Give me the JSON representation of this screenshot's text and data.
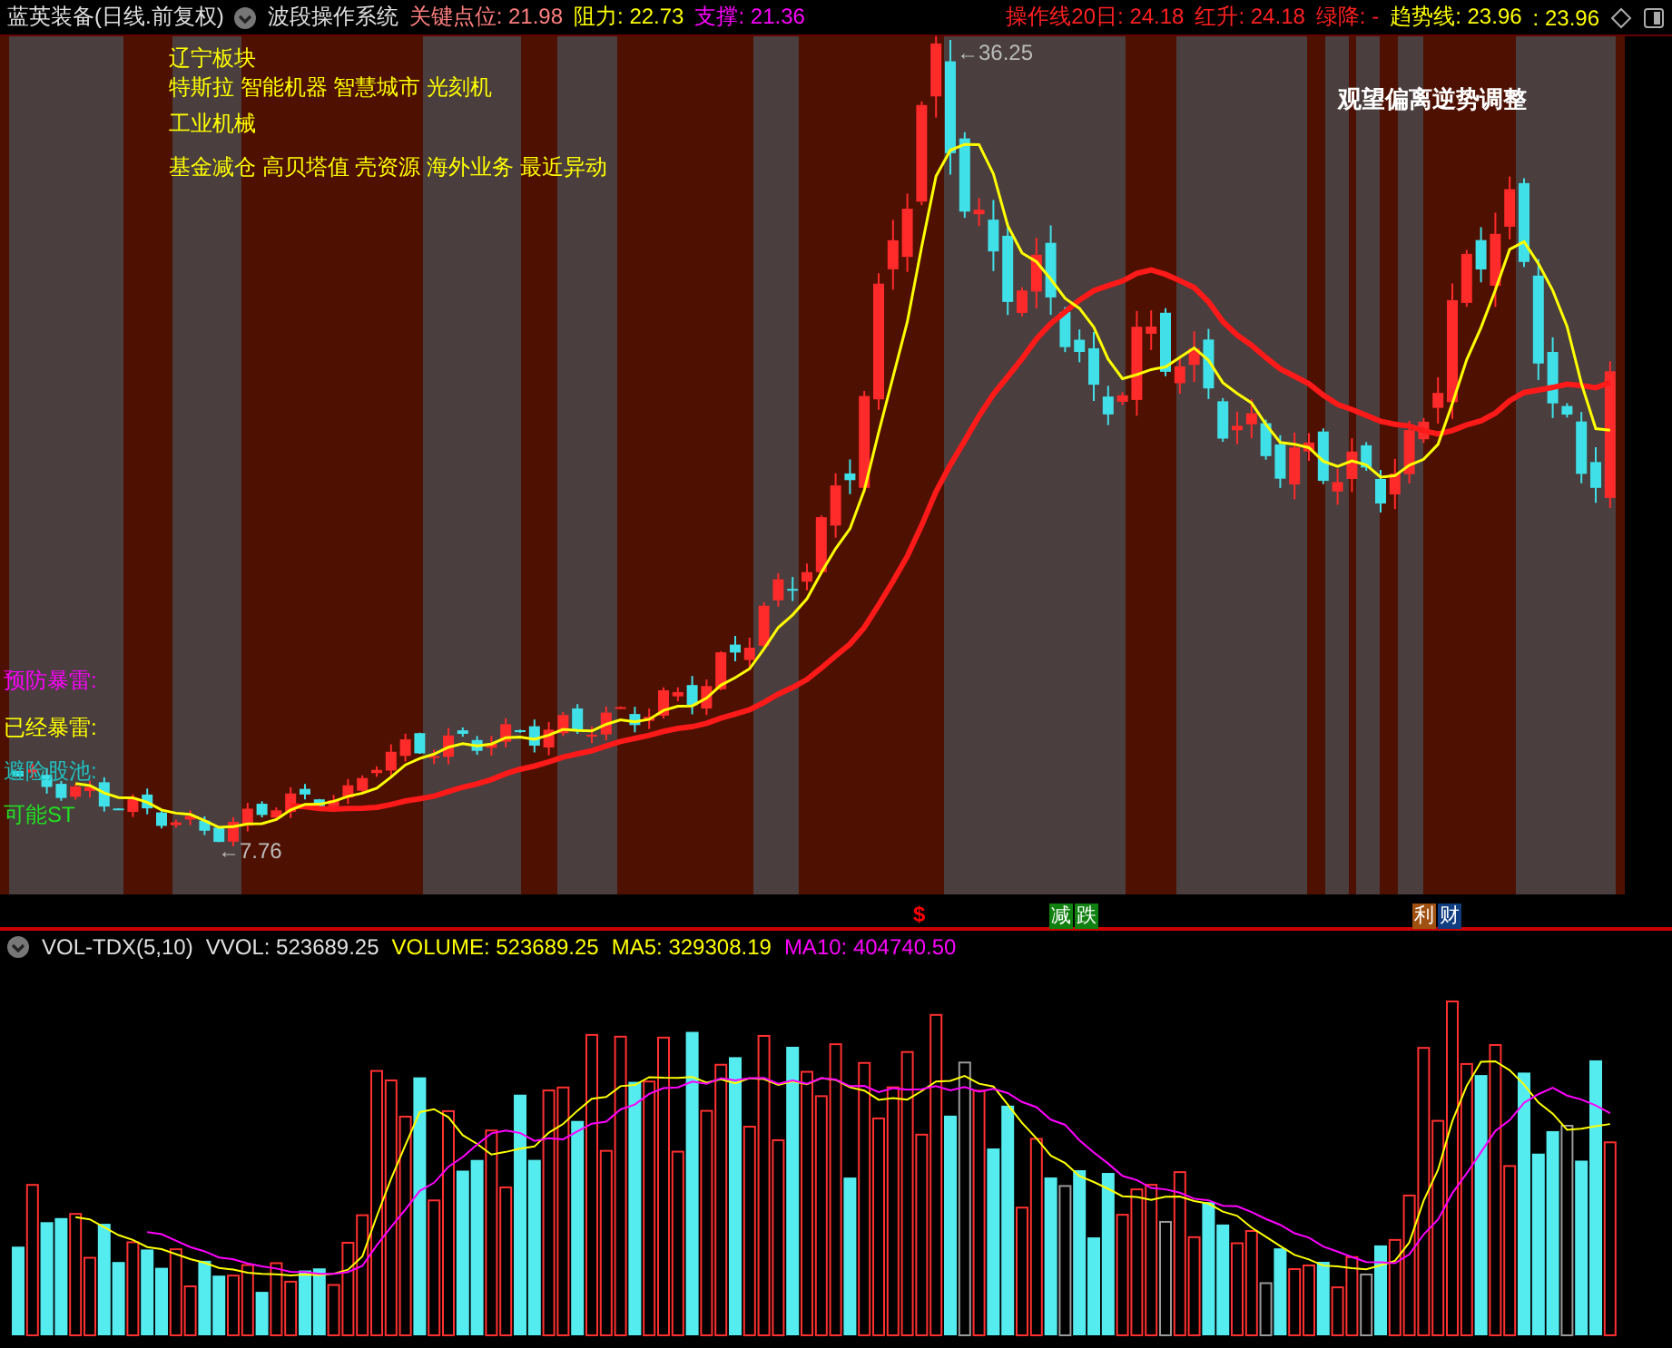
{
  "header": {
    "stock": "蓝英装备(日线.前复权)",
    "system": "波段操作系统",
    "indicators": [
      {
        "text": "关键点位: 21.98",
        "color": "#ff7f7f"
      },
      {
        "text": "阻力: 22.73",
        "color": "#ffff00"
      },
      {
        "text": "支撑: 21.36",
        "color": "#ff00ff"
      }
    ],
    "right_indicators": [
      {
        "text": "操作线20日: 24.18",
        "color": "#ff2020"
      },
      {
        "text": "红升: 24.18",
        "color": "#ff2020"
      },
      {
        "text": "绿降: -",
        "color": "#ff2020"
      },
      {
        "text": "趋势线: 23.96",
        "color": "#ffff00"
      },
      {
        "text": ": 23.96",
        "color": "#ffff00"
      }
    ]
  },
  "chart": {
    "high_label": "←36.25",
    "low_label": "←7.76",
    "notes": [
      "辽宁板块",
      "特斯拉 智能机器 智慧城市 光刻机",
      "工业机械",
      "基金减仓 高贝塔值 壳资源 海外业务 最近异动"
    ],
    "signal_text": "观望偏离逆势调整",
    "side_labels": [
      {
        "text": "预防暴雷:",
        "color": "#ff00ff"
      },
      {
        "text": "已经暴雷:",
        "color": "#ffff00"
      },
      {
        "text": "避险股池:",
        "color": "#20c0c0"
      },
      {
        "text": "可能ST",
        "color": "#20e020"
      }
    ]
  },
  "markers": [
    {
      "text": "$",
      "color": "#ff0000"
    },
    {
      "text": "减",
      "color": "#108010"
    },
    {
      "text": "跌",
      "color": "#108010"
    },
    {
      "text": "利",
      "color": "#a05010"
    },
    {
      "text": "财",
      "color": "#103c80"
    }
  ],
  "volume": {
    "title": "VOL-TDX(5,10)",
    "readings": [
      {
        "text": "VVOL: 523689.25",
        "color": "#e0e0e0"
      },
      {
        "text": "VOLUME: 523689.25",
        "color": "#ffff00"
      },
      {
        "text": "MA5: 329308.19",
        "color": "#ffff00"
      },
      {
        "text": "MA10: 404740.50",
        "color": "#ff00ff"
      }
    ]
  }
}
